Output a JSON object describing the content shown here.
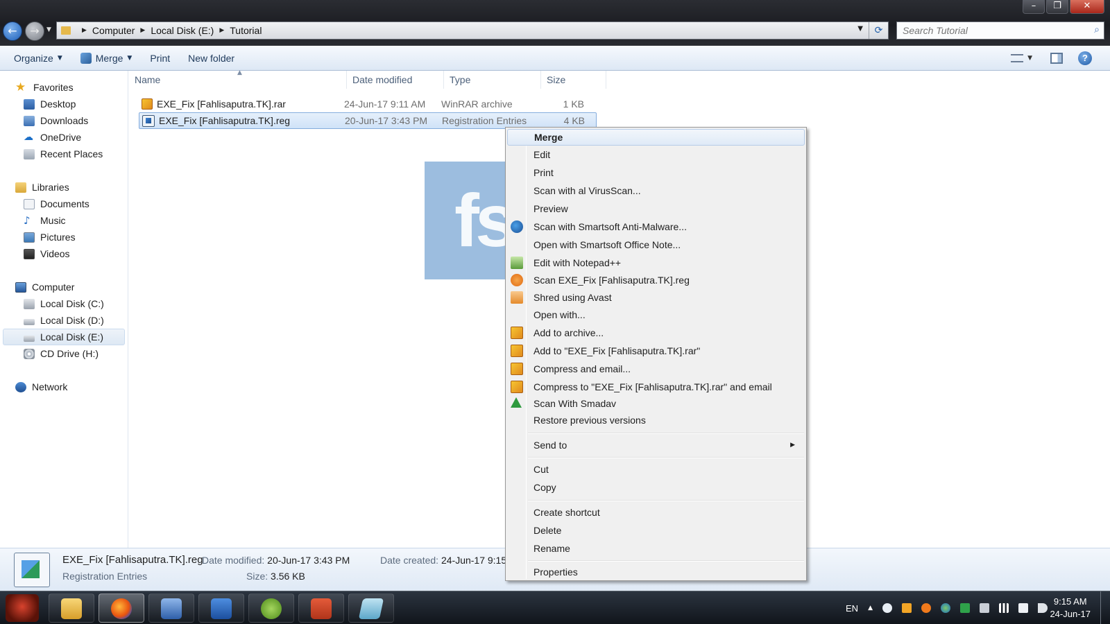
{
  "window": {
    "controls": [
      "minimize-icon",
      "maximize-icon",
      "close-icon"
    ]
  },
  "address": {
    "crumbs": [
      "Computer",
      "Local Disk (E:)",
      "Tutorial"
    ],
    "search_placeholder": "Search Tutorial"
  },
  "toolbar": {
    "organize": "Organize",
    "merge": "Merge",
    "print": "Print",
    "new_folder": "New folder"
  },
  "sidebar": {
    "favorites": "Favorites",
    "favorites_items": [
      "Desktop",
      "Downloads",
      "OneDrive",
      "Recent Places"
    ],
    "libraries": "Libraries",
    "libraries_items": [
      "Documents",
      "Music",
      "Pictures",
      "Videos"
    ],
    "computer": "Computer",
    "computer_items": [
      "Local Disk (C:)",
      "Local Disk (D:)",
      "Local Disk (E:)",
      "CD Drive (H:)"
    ],
    "selected": "Local Disk (E:)",
    "network": "Network"
  },
  "columns": [
    "Name",
    "Date modified",
    "Type",
    "Size"
  ],
  "files": [
    {
      "name": "EXE_Fix [Fahlisaputra.TK].rar",
      "date": "24-Jun-17 9:11 AM",
      "type": "WinRAR archive",
      "size": "1 KB",
      "icon": "rar-icon"
    },
    {
      "name": "EXE_Fix [Fahlisaputra.TK].reg",
      "date": "20-Jun-17 3:43 PM",
      "type": "Registration Entries",
      "size": "4 KB",
      "icon": "reg-icon",
      "selected": true
    }
  ],
  "watermark": "fs",
  "context_menu": {
    "items": [
      "Merge",
      "Edit",
      "Print",
      "Scan with al VirusScan...",
      "Preview",
      "Scan with Smartsoft Anti-Malware...",
      "Open with Smartsoft Office Note...",
      "Edit with Notepad++",
      "Scan EXE_Fix [Fahlisaputra.TK].reg",
      "Shred using Avast",
      "Open with...",
      "Add to archive...",
      "Add to \"EXE_Fix [Fahlisaputra.TK].rar\"",
      "Compress and email...",
      "Compress to \"EXE_Fix [Fahlisaputra.TK].rar\" and email",
      "Scan With Smadav",
      "Restore previous versions",
      "Send to",
      "Cut",
      "Copy",
      "Create shortcut",
      "Delete",
      "Rename",
      "Properties"
    ],
    "default_item": "Merge"
  },
  "details": {
    "name": "EXE_Fix [Fahlisaputra.TK].reg",
    "type": "Registration Entries",
    "modified_label": "Date modified:",
    "modified_value": "20-Jun-17 3:43 PM",
    "created_label": "Date created:",
    "created_value": "24-Jun-17 9:15",
    "size_label": "Size:",
    "size_value": "3.56 KB"
  },
  "taskbar": {
    "apps": [
      "explorer",
      "firefox",
      "vm-player",
      "visual-basic",
      "android-studio",
      "powerpoint",
      "notepad"
    ],
    "language": "EN",
    "time": "9:15 AM",
    "date": "24-Jun-17"
  },
  "colors": {
    "titlebar": "#1c1d22",
    "selection": "#cfe2f8",
    "menu_bg": "#f0f0f0",
    "watermark": "#4a87c4"
  }
}
